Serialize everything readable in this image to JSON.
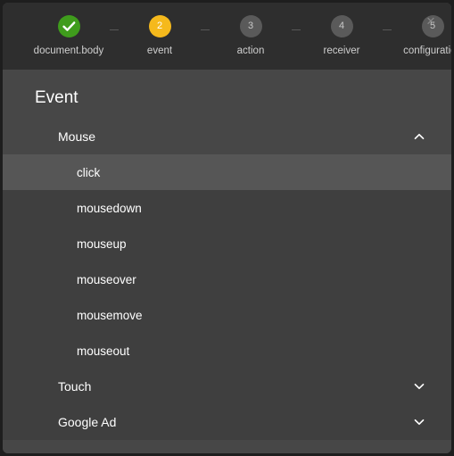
{
  "window": {
    "close_label": "×",
    "close_icon": "close-icon",
    "bg_color": "#474747",
    "header_bg_color": "#2e2e2e"
  },
  "stepper": {
    "steps": [
      {
        "index": "1",
        "marker": "✓",
        "label": "document.body",
        "state": "done",
        "color": "#3f9c1c"
      },
      {
        "index": "2",
        "marker": "2",
        "label": "event",
        "state": "active",
        "color": "#f5b91c"
      },
      {
        "index": "3",
        "marker": "3",
        "label": "action",
        "state": "inactive",
        "color": "#5a5a5a"
      },
      {
        "index": "4",
        "marker": "4",
        "label": "receiver",
        "state": "inactive",
        "color": "#5a5a5a"
      },
      {
        "index": "5",
        "marker": "5",
        "label": "configuration",
        "state": "inactive",
        "color": "#5a5a5a"
      }
    ]
  },
  "panel": {
    "title": "Event"
  },
  "groups": [
    {
      "name": "Mouse",
      "expanded": true,
      "chevron_icon": "chevron-up-icon",
      "items": [
        {
          "label": "click",
          "selected": true
        },
        {
          "label": "mousedown",
          "selected": false
        },
        {
          "label": "mouseup",
          "selected": false
        },
        {
          "label": "mouseover",
          "selected": false
        },
        {
          "label": "mousemove",
          "selected": false
        },
        {
          "label": "mouseout",
          "selected": false
        }
      ]
    },
    {
      "name": "Touch",
      "expanded": false,
      "chevron_icon": "chevron-down-icon",
      "items": []
    },
    {
      "name": "Google Ad",
      "expanded": false,
      "chevron_icon": "chevron-down-icon",
      "items": []
    }
  ]
}
